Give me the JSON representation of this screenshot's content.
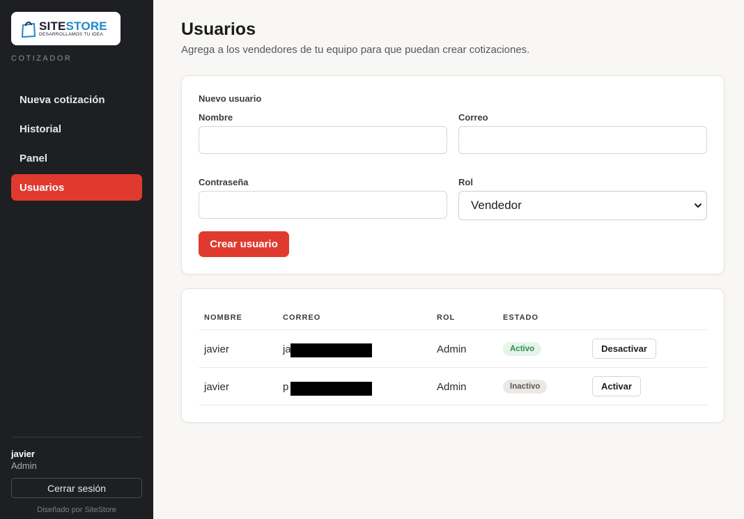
{
  "sidebar": {
    "logo": {
      "main_a": "SITE",
      "main_b": "STORE",
      "tagline": "DESARROLLAMOS TU IDEA"
    },
    "section_label": "COTIZADOR",
    "items": [
      {
        "label": "Nueva cotización"
      },
      {
        "label": "Historial"
      },
      {
        "label": "Panel"
      },
      {
        "label": "Usuarios"
      }
    ],
    "user": {
      "name": "javier",
      "role": "Admin"
    },
    "logout_label": "Cerrar sesión",
    "credit": "Diseñado por SiteStore"
  },
  "page": {
    "title": "Usuarios",
    "subtitle": "Agrega a los vendedores de tu equipo para que puedan crear cotizaciones."
  },
  "form": {
    "heading": "Nuevo usuario",
    "name_label": "Nombre",
    "email_label": "Correo",
    "password_label": "Contraseña",
    "role_label": "Rol",
    "role_selected": "Vendedor",
    "submit_label": "Crear usuario"
  },
  "table": {
    "headers": [
      "NOMBRE",
      "CORREO",
      "ROL",
      "ESTADO"
    ],
    "rows": [
      {
        "name": "javier",
        "email_prefix": "ja",
        "role": "Admin",
        "status": "Activo",
        "action": "Desactivar"
      },
      {
        "name": "javier",
        "email_prefix": "p",
        "role": "Admin",
        "status": "Inactivo",
        "action": "Activar"
      }
    ]
  },
  "colors": {
    "accent": "#e03a2f",
    "sidebar_bg": "#1e1f22",
    "brand_blue": "#1e88c8",
    "status_active": "#2e8b4f"
  }
}
